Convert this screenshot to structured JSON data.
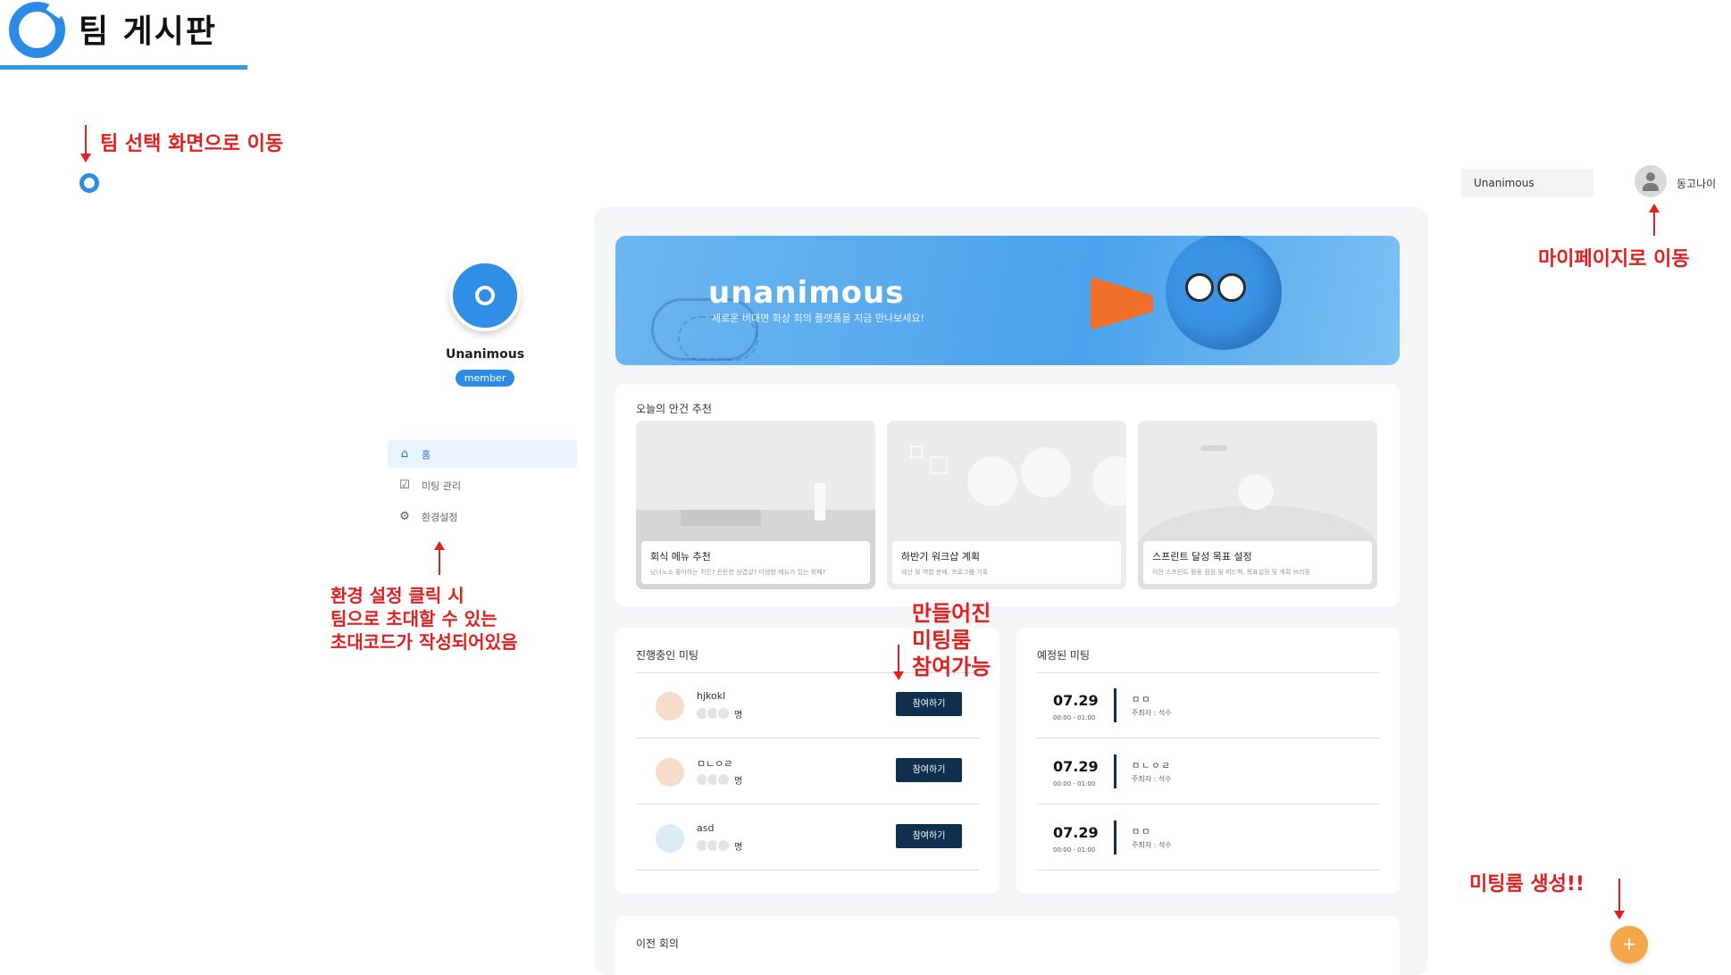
{
  "header": {
    "title": "팀 게시판"
  },
  "annotations": {
    "team_select": "팀 선택 화면으로 이동",
    "mypage": "마이페이지로 이동",
    "settings": [
      "환경 설정 클릭 시",
      "팀으로 초대할 수 있는",
      "초대코드가 작성되어있음"
    ],
    "join": [
      "만들어진",
      "미팅룸",
      "참여가능"
    ],
    "create": "미팅룸 생성!!"
  },
  "topbar": {
    "team_select_value": "Unanimous",
    "user_name": "동고나이"
  },
  "sidebar": {
    "team_name": "Unanimous",
    "role": "member",
    "items": [
      {
        "label": "홈",
        "icon": "home-icon",
        "active": true
      },
      {
        "label": "미팅 관리",
        "icon": "calendar-check-icon",
        "active": false
      },
      {
        "label": "환경설정",
        "icon": "gear-icon",
        "active": false
      }
    ]
  },
  "banner": {
    "title": "unanimous",
    "subtitle": "새로운 비대면 화상 회의 플랫폼을 지금 만나보세요!"
  },
  "agenda": {
    "title": "오늘의 안건 추천",
    "cards": [
      {
        "title": "회식 메뉴 추천",
        "desc": "남녀노소 좋아하는 치킨? 든든한 삼겹살? 다양한 메뉴가 있는 뷔페?"
      },
      {
        "title": "하반기 워크샵 계획",
        "desc": "예산 및 역할 분배, 프로그램 기획"
      },
      {
        "title": "스프린트 달성 목표 설정",
        "desc": "이전 스프린트 활동 점검 및 피드백, 목표설정 및 계획 브리핑"
      }
    ]
  },
  "ongoing": {
    "title": "진행중인 미팅",
    "unit": "명",
    "join_label": "참여하기",
    "meetings": [
      {
        "name": "hjkokl",
        "icon": "clock-icon",
        "icon_color": "#f6dccb"
      },
      {
        "name": "ㅁㄴㅇㄹ",
        "icon": "clock-icon",
        "icon_color": "#f6dccb"
      },
      {
        "name": "asd",
        "icon": "utensils-icon",
        "icon_color": "#dcecf7"
      }
    ]
  },
  "scheduled": {
    "title": "예정된 미팅",
    "meetings": [
      {
        "date": "07.29",
        "time": "00:00 - 01:00",
        "title": "ㅁㅁ",
        "host": "주최자 : 석수"
      },
      {
        "date": "07.29",
        "time": "00:00 - 01:00",
        "title": "ㅁㄴㅇㄹ",
        "host": "주최자 : 석수"
      },
      {
        "date": "07.29",
        "time": "00:00 - 01:00",
        "title": "ㅁㅁ",
        "host": "주최자 : 석수"
      }
    ]
  },
  "previous": {
    "title": "이전 회의"
  },
  "fab": {
    "label": "+"
  }
}
